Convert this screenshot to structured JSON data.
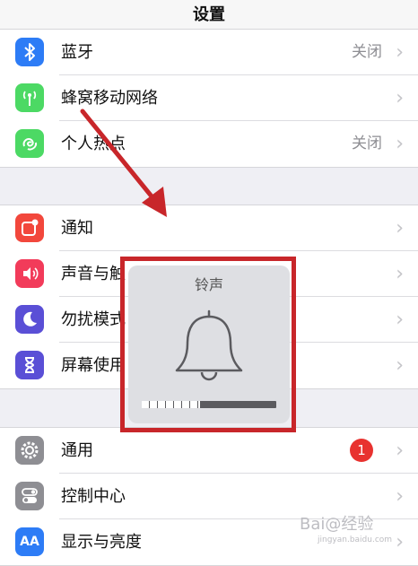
{
  "navbar": {
    "title": "设置"
  },
  "group1": [
    {
      "label": "蓝牙",
      "value": "关闭",
      "icon": "bluetooth-icon",
      "color": "#2d7cf6"
    },
    {
      "label": "蜂窝移动网络",
      "value": "",
      "icon": "antenna-icon",
      "color": "#4cd964"
    },
    {
      "label": "个人热点",
      "value": "关闭",
      "icon": "hotspot-icon",
      "color": "#4cd964"
    }
  ],
  "group2": [
    {
      "label": "通知",
      "icon": "notification-icon",
      "color": "#f2473c"
    },
    {
      "label": "声音与触",
      "icon": "speaker-icon",
      "color": "#f23b5a"
    },
    {
      "label": "勿扰模式",
      "icon": "moon-icon",
      "color": "#5a4fd6"
    },
    {
      "label": "屏幕使用",
      "icon": "hourglass-icon",
      "color": "#5a4fd6"
    }
  ],
  "group3": [
    {
      "label": "通用",
      "badge": "1",
      "icon": "gear-icon",
      "color": "#8e8e93"
    },
    {
      "label": "控制中心",
      "icon": "toggles-icon",
      "color": "#8e8e93"
    },
    {
      "label": "显示与亮度",
      "icon": "text-size-icon",
      "color": "#2d7cf6",
      "icon_text": "AA"
    }
  ],
  "popup": {
    "title": "铃声",
    "volume_fraction": 0.43
  },
  "watermark": {
    "text": "Bai@经验",
    "sub": "jingyan.baidu.com"
  }
}
